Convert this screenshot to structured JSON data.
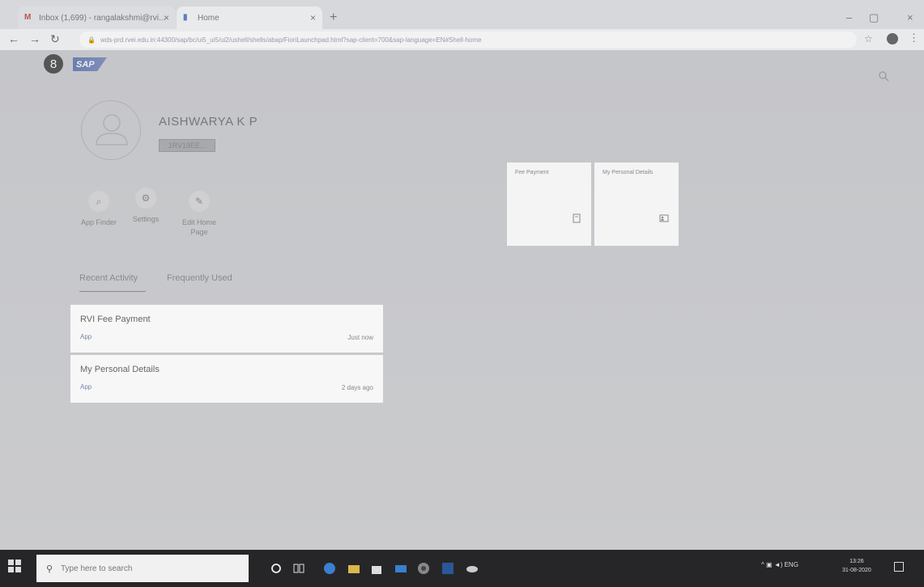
{
  "browser": {
    "tabs": [
      {
        "icon": "gmail-icon",
        "label": "Inbox (1,699) - rangalakshmi@rvi..."
      },
      {
        "icon": "sap-icon",
        "label": "Home"
      }
    ],
    "url": "wds-prd.rvei.edu.in:44300/sap/bc/ui5_ui5/ui2/ushell/shells/abap/FioriLaunchpad.html?sap-client=700&sap-language=EN#Shell-home"
  },
  "shell": {
    "avatar_initial": "8",
    "logo_text": "SAP"
  },
  "user": {
    "name": "AISHWARYA K P",
    "id": "1RV19EE..."
  },
  "actions": [
    {
      "label": "App Finder"
    },
    {
      "label": "Settings"
    },
    {
      "label": "Edit Home Page"
    }
  ],
  "activity_tabs": {
    "recent": "Recent Activity",
    "frequent": "Frequently Used"
  },
  "recent_items": [
    {
      "title": "RVI Fee Payment",
      "type": "App",
      "time": "Just now"
    },
    {
      "title": "My Personal Details",
      "type": "App",
      "time": "2 days ago"
    }
  ],
  "tiles": [
    {
      "title": "Fee Payment"
    },
    {
      "title": "My Personal Details"
    }
  ],
  "taskbar": {
    "search_placeholder": "Type here to search",
    "tray_text": "ENG",
    "time": "13:26",
    "date": "31-08-2020"
  }
}
